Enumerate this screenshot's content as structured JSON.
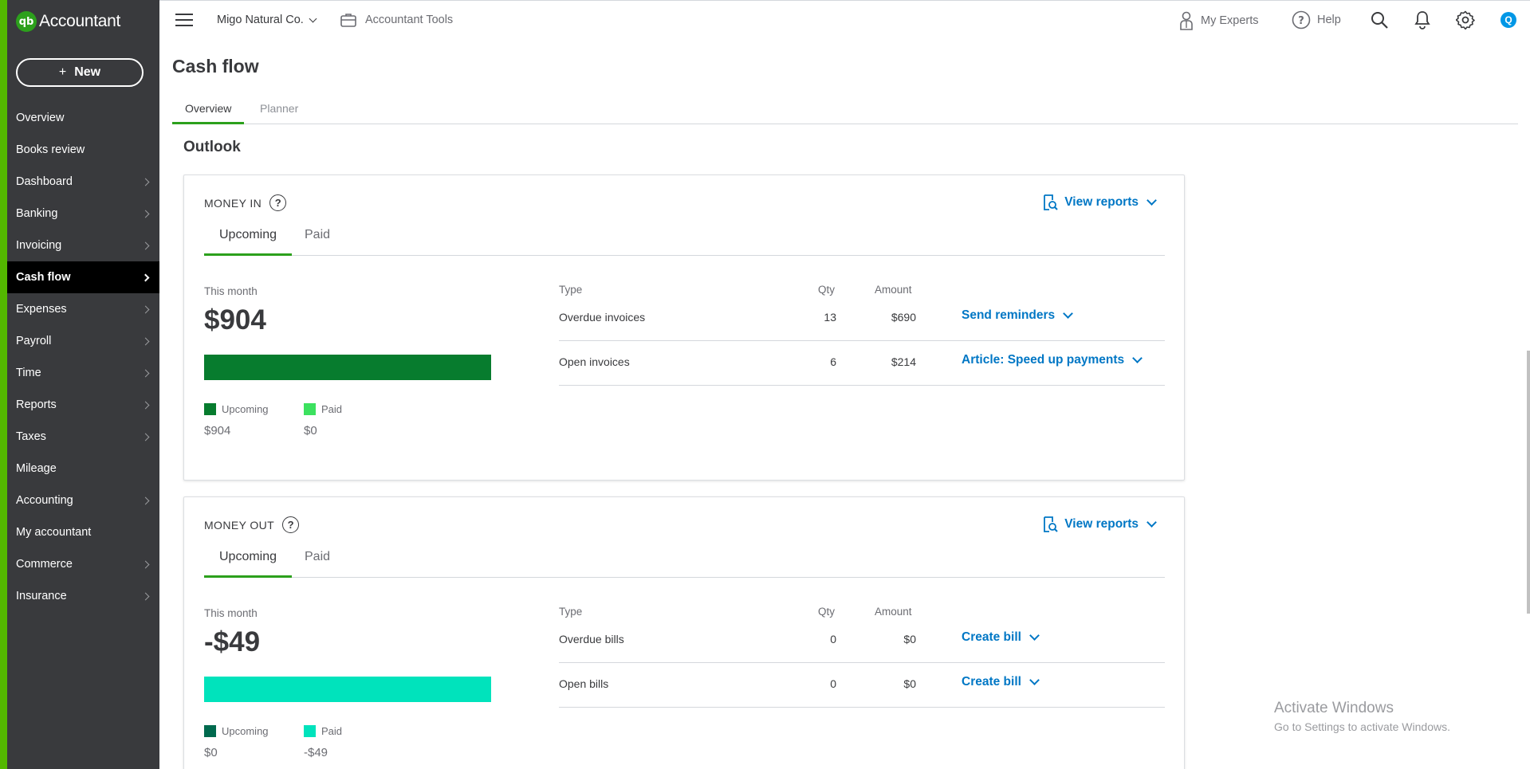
{
  "app": {
    "name": "Accountant",
    "logo_text": "qb"
  },
  "sidebar": {
    "new_label": "New",
    "items": [
      {
        "label": "Overview",
        "has_chevron": false,
        "active": false
      },
      {
        "label": "Books review",
        "has_chevron": false,
        "active": false
      },
      {
        "label": "Dashboard",
        "has_chevron": true,
        "active": false
      },
      {
        "label": "Banking",
        "has_chevron": true,
        "active": false
      },
      {
        "label": "Invoicing",
        "has_chevron": true,
        "active": false
      },
      {
        "label": "Cash flow",
        "has_chevron": true,
        "active": true
      },
      {
        "label": "Expenses",
        "has_chevron": true,
        "active": false
      },
      {
        "label": "Payroll",
        "has_chevron": true,
        "active": false
      },
      {
        "label": "Time",
        "has_chevron": true,
        "active": false
      },
      {
        "label": "Reports",
        "has_chevron": true,
        "active": false
      },
      {
        "label": "Taxes",
        "has_chevron": true,
        "active": false
      },
      {
        "label": "Mileage",
        "has_chevron": false,
        "active": false
      },
      {
        "label": "Accounting",
        "has_chevron": true,
        "active": false
      },
      {
        "label": "My accountant",
        "has_chevron": false,
        "active": false
      },
      {
        "label": "Commerce",
        "has_chevron": true,
        "active": false
      },
      {
        "label": "Insurance",
        "has_chevron": true,
        "active": false
      }
    ]
  },
  "topbar": {
    "company": "Migo Natural Co.",
    "accountant_tools": "Accountant Tools",
    "my_experts": "My Experts",
    "help": "Help",
    "avatar_initial": "Q"
  },
  "page": {
    "title": "Cash flow",
    "tabs": [
      "Overview",
      "Planner"
    ],
    "section_title": "Outlook"
  },
  "money_in": {
    "heading": "MONEY IN",
    "view_reports": "View reports",
    "tabs": [
      "Upcoming",
      "Paid"
    ],
    "this_month_label": "This month",
    "amount": "$904",
    "bar_upcoming_fraction": 1.0,
    "legend": [
      {
        "label": "Upcoming",
        "value": "$904",
        "color": "#077c2e"
      },
      {
        "label": "Paid",
        "value": "$0",
        "color": "#3ce15f"
      }
    ],
    "table": {
      "headers": {
        "type": "Type",
        "qty": "Qty",
        "amount": "Amount"
      },
      "rows": [
        {
          "type": "Overdue invoices",
          "qty": "13",
          "amount": "$690",
          "action": "Send reminders"
        },
        {
          "type": "Open invoices",
          "qty": "6",
          "amount": "$214",
          "action": "Article: Speed up payments"
        }
      ]
    }
  },
  "money_out": {
    "heading": "MONEY OUT",
    "view_reports": "View reports",
    "tabs": [
      "Upcoming",
      "Paid"
    ],
    "this_month_label": "This month",
    "amount": "-$49",
    "bar_paid_fraction": 1.0,
    "legend": [
      {
        "label": "Upcoming",
        "value": "$0",
        "color": "#006a4e"
      },
      {
        "label": "Paid",
        "value": "-$49",
        "color": "#00e3bc"
      }
    ],
    "table": {
      "headers": {
        "type": "Type",
        "qty": "Qty",
        "amount": "Amount"
      },
      "rows": [
        {
          "type": "Overdue bills",
          "qty": "0",
          "amount": "$0",
          "action": "Create bill"
        },
        {
          "type": "Open bills",
          "qty": "0",
          "amount": "$0",
          "action": "Create bill"
        }
      ]
    }
  },
  "watermark": {
    "line1": "Activate Windows",
    "line2": "Go to Settings to activate Windows."
  },
  "colors": {
    "brand_green": "#2ca01c",
    "link_blue": "#0077c5",
    "sidebar_bg": "#393a3d"
  }
}
